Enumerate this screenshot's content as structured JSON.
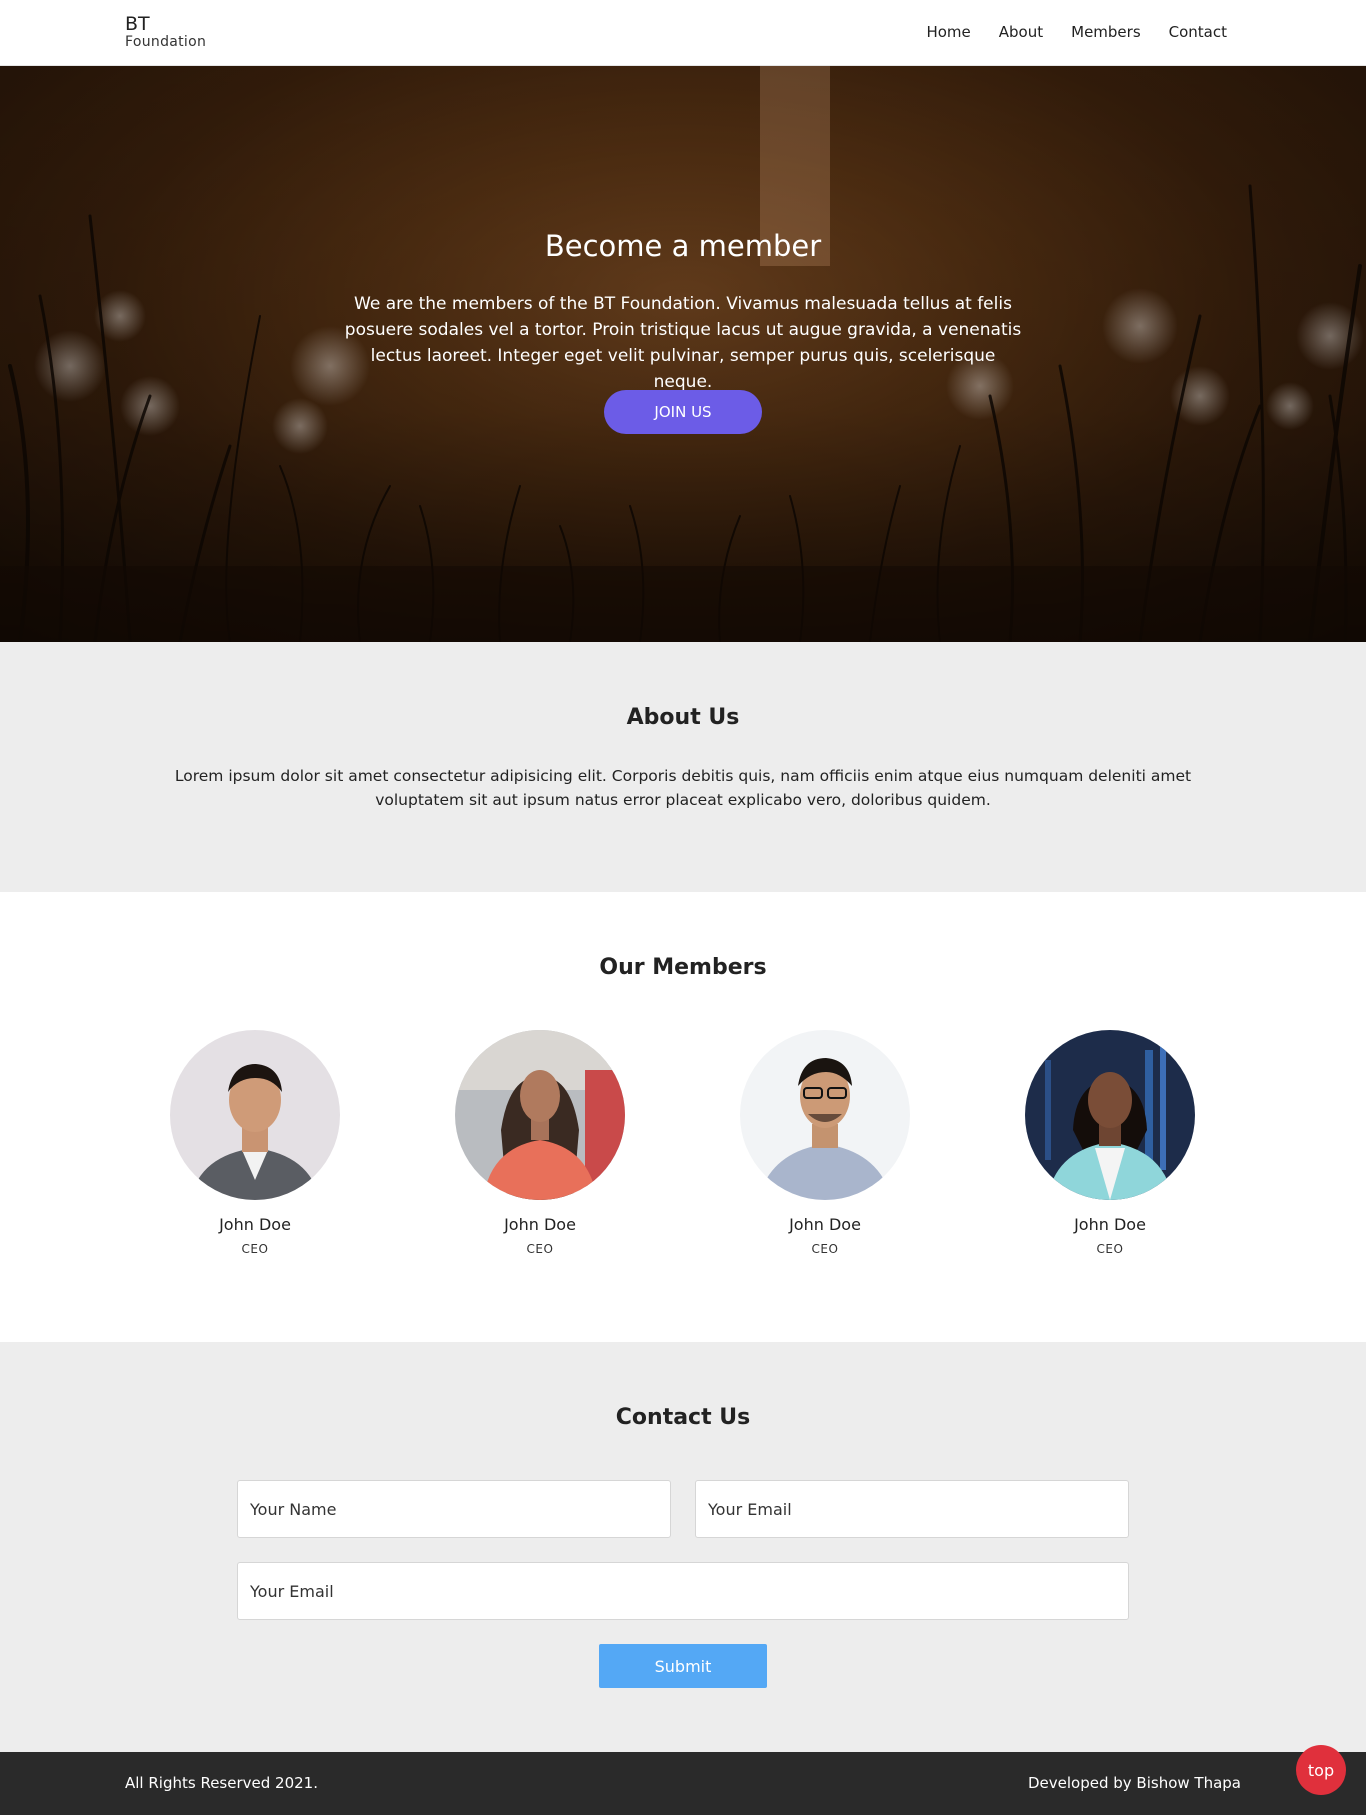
{
  "brand": {
    "line1": "BT",
    "line2": "Foundation"
  },
  "nav": {
    "items": [
      "Home",
      "About",
      "Members",
      "Contact"
    ]
  },
  "hero": {
    "title": "Become a member",
    "text": "We are the members of the BT Foundation. Vivamus malesuada tellus at felis posuere sodales vel a tortor. Proin tristique lacus ut augue gravida, a venenatis lectus laoreet. Integer eget velit pulvinar, semper purus quis, scelerisque neque.",
    "button": "JOIN US"
  },
  "about": {
    "title": "About Us",
    "text": "Lorem ipsum dolor sit amet consectetur adipisicing elit. Corporis debitis quis, nam officiis enim atque eius numquam deleniti amet voluptatem sit aut ipsum natus error placeat explicabo vero, doloribus quidem."
  },
  "members": {
    "title": "Our Members",
    "list": [
      {
        "name": "John Doe",
        "role": "CEO"
      },
      {
        "name": "John Doe",
        "role": "CEO"
      },
      {
        "name": "John Doe",
        "role": "CEO"
      },
      {
        "name": "John Doe",
        "role": "CEO"
      }
    ]
  },
  "contact": {
    "title": "Contact Us",
    "name_placeholder": "Your Name",
    "email_placeholder": "Your Email",
    "message_placeholder": "Your Email",
    "submit": "Submit"
  },
  "footer": {
    "left": "All Rights Reserved 2021.",
    "right": "Developed by Bishow Thapa"
  },
  "top_button": "top",
  "colors": {
    "accent": "#6c5ce7",
    "submit": "#54a8f5",
    "top": "#e0303c",
    "footer": "#2a2a2a",
    "section_bg": "#ededed"
  }
}
